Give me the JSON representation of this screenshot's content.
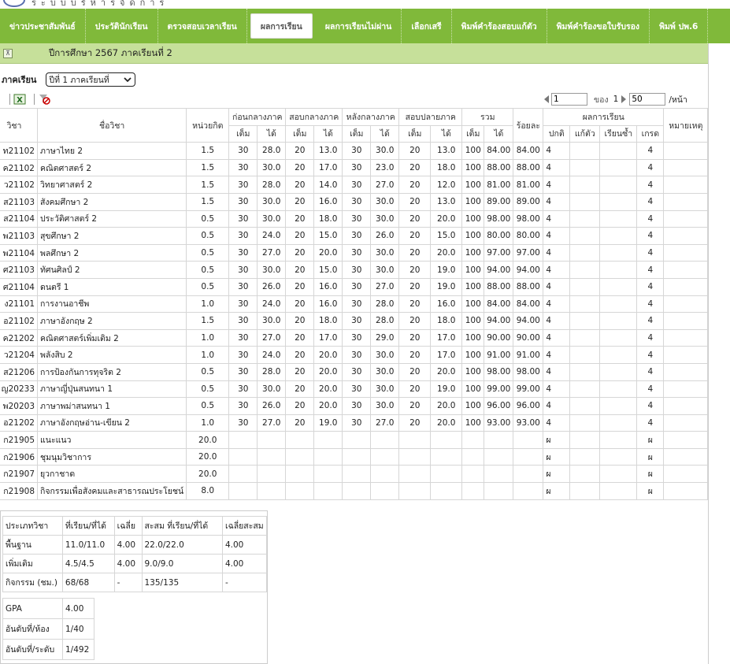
{
  "top_strip_text": "ระบบบริหารจัดการ",
  "nav": {
    "tabs": [
      {
        "label": "ข่าวประชาสัมพันธ์",
        "active": false
      },
      {
        "label": "ประวัตินักเรียน",
        "active": false
      },
      {
        "label": "ตรวจสอบเวลาเรียน",
        "active": false
      },
      {
        "label": "ผลการเรียน",
        "active": true
      },
      {
        "label": "ผลการเรียนไม่ผ่าน",
        "active": false
      },
      {
        "label": "เลือกเสรี",
        "active": false
      },
      {
        "label": "พิมพ์คำร้องสอบแก้ตัว",
        "active": false
      },
      {
        "label": "พิมพ์คำร้องขอใบรับรอง",
        "active": false
      },
      {
        "label": "พิมพ์ ปพ.6",
        "active": false
      }
    ]
  },
  "panel": {
    "collapse_icon": "⊼",
    "title": "ปีการศึกษา 2567 ภาคเรียนที่ 2"
  },
  "semester": {
    "label": "ภาคเรียน",
    "selected": "ปีที่ 1 ภาคเรียนที่"
  },
  "pager": {
    "page": "1",
    "of_label": "ของ",
    "total_pages": "1",
    "page_size": "50",
    "per_page_label": "/หน้า"
  },
  "table": {
    "headers": {
      "code": "วิชา",
      "name": "ชื่อวิชา",
      "credit": "หน่วยกิต",
      "midterm_before": "ก่อนกลางภาค",
      "midterm": "สอบกลางภาค",
      "after_mid": "หลังกลางภาค",
      "final": "สอบปลายภาค",
      "total": "รวม",
      "percent": "ร้อยละ",
      "result": "ผลการเรียน",
      "remark": "หมายเหตุ",
      "full": "เต็ม",
      "got": "ได้",
      "normal": "ปกติ",
      "retest": "แก้ตัว",
      "repeat": "เรียนซ้ำ",
      "grade": "เกรด"
    },
    "rows": [
      {
        "code": "ท21102",
        "name": "ภาษาไทย 2",
        "credit": "1.5",
        "s": [
          "30",
          "28.0",
          "20",
          "13.0",
          "30",
          "30.0",
          "20",
          "13.0",
          "100",
          "84.00"
        ],
        "pct": "84.00",
        "normal": "4",
        "retest": "",
        "repeat": "",
        "grade": "4",
        "remark": ""
      },
      {
        "code": "ค21102",
        "name": "คณิตศาสตร์ 2",
        "credit": "1.5",
        "s": [
          "30",
          "30.0",
          "20",
          "17.0",
          "30",
          "23.0",
          "20",
          "18.0",
          "100",
          "88.00"
        ],
        "pct": "88.00",
        "normal": "4",
        "retest": "",
        "repeat": "",
        "grade": "4",
        "remark": ""
      },
      {
        "code": "ว21102",
        "name": "วิทยาศาสตร์ 2",
        "credit": "1.5",
        "s": [
          "30",
          "28.0",
          "20",
          "14.0",
          "30",
          "27.0",
          "20",
          "12.0",
          "100",
          "81.00"
        ],
        "pct": "81.00",
        "normal": "4",
        "retest": "",
        "repeat": "",
        "grade": "4",
        "remark": ""
      },
      {
        "code": "ส21103",
        "name": "สังคมศึกษา 2",
        "credit": "1.5",
        "s": [
          "30",
          "30.0",
          "20",
          "16.0",
          "30",
          "30.0",
          "20",
          "13.0",
          "100",
          "89.00"
        ],
        "pct": "89.00",
        "normal": "4",
        "retest": "",
        "repeat": "",
        "grade": "4",
        "remark": ""
      },
      {
        "code": "ส21104",
        "name": "ประวัติศาสตร์ 2",
        "credit": "0.5",
        "s": [
          "30",
          "30.0",
          "20",
          "18.0",
          "30",
          "30.0",
          "20",
          "20.0",
          "100",
          "98.00"
        ],
        "pct": "98.00",
        "normal": "4",
        "retest": "",
        "repeat": "",
        "grade": "4",
        "remark": ""
      },
      {
        "code": "พ21103",
        "name": "สุขศึกษา 2",
        "credit": "0.5",
        "s": [
          "30",
          "24.0",
          "20",
          "15.0",
          "30",
          "26.0",
          "20",
          "15.0",
          "100",
          "80.00"
        ],
        "pct": "80.00",
        "normal": "4",
        "retest": "",
        "repeat": "",
        "grade": "4",
        "remark": ""
      },
      {
        "code": "พ21104",
        "name": "พลศึกษา 2",
        "credit": "0.5",
        "s": [
          "30",
          "27.0",
          "20",
          "20.0",
          "30",
          "30.0",
          "20",
          "20.0",
          "100",
          "97.00"
        ],
        "pct": "97.00",
        "normal": "4",
        "retest": "",
        "repeat": "",
        "grade": "4",
        "remark": ""
      },
      {
        "code": "ศ21103",
        "name": "ทัศนศิลป์ 2",
        "credit": "0.5",
        "s": [
          "30",
          "30.0",
          "20",
          "15.0",
          "30",
          "30.0",
          "20",
          "19.0",
          "100",
          "94.00"
        ],
        "pct": "94.00",
        "normal": "4",
        "retest": "",
        "repeat": "",
        "grade": "4",
        "remark": ""
      },
      {
        "code": "ศ21104",
        "name": "ดนตรี 1",
        "credit": "0.5",
        "s": [
          "30",
          "26.0",
          "20",
          "16.0",
          "30",
          "27.0",
          "20",
          "19.0",
          "100",
          "88.00"
        ],
        "pct": "88.00",
        "normal": "4",
        "retest": "",
        "repeat": "",
        "grade": "4",
        "remark": ""
      },
      {
        "code": "ง21101",
        "name": "การงานอาชีพ",
        "credit": "1.0",
        "s": [
          "30",
          "24.0",
          "20",
          "16.0",
          "30",
          "28.0",
          "20",
          "16.0",
          "100",
          "84.00"
        ],
        "pct": "84.00",
        "normal": "4",
        "retest": "",
        "repeat": "",
        "grade": "4",
        "remark": ""
      },
      {
        "code": "อ21102",
        "name": "ภาษาอังกฤษ 2",
        "credit": "1.5",
        "s": [
          "30",
          "30.0",
          "20",
          "18.0",
          "30",
          "28.0",
          "20",
          "18.0",
          "100",
          "94.00"
        ],
        "pct": "94.00",
        "normal": "4",
        "retest": "",
        "repeat": "",
        "grade": "4",
        "remark": ""
      },
      {
        "code": "ค21202",
        "name": "คณิตศาสตร์เพิ่มเติม 2",
        "credit": "1.0",
        "s": [
          "30",
          "27.0",
          "20",
          "17.0",
          "30",
          "29.0",
          "20",
          "17.0",
          "100",
          "90.00"
        ],
        "pct": "90.00",
        "normal": "4",
        "retest": "",
        "repeat": "",
        "grade": "4",
        "remark": ""
      },
      {
        "code": "ว21204",
        "name": "พลังสิบ 2",
        "credit": "1.0",
        "s": [
          "30",
          "24.0",
          "20",
          "20.0",
          "30",
          "30.0",
          "20",
          "17.0",
          "100",
          "91.00"
        ],
        "pct": "91.00",
        "normal": "4",
        "retest": "",
        "repeat": "",
        "grade": "4",
        "remark": ""
      },
      {
        "code": "ส21206",
        "name": "การป้องกันการทุจริต 2",
        "credit": "0.5",
        "s": [
          "30",
          "28.0",
          "20",
          "20.0",
          "30",
          "30.0",
          "20",
          "20.0",
          "100",
          "98.00"
        ],
        "pct": "98.00",
        "normal": "4",
        "retest": "",
        "repeat": "",
        "grade": "4",
        "remark": ""
      },
      {
        "code": "ญ20233",
        "name": "ภาษาญี่ปุ่นสนทนา 1",
        "credit": "0.5",
        "s": [
          "30",
          "30.0",
          "20",
          "20.0",
          "30",
          "30.0",
          "20",
          "19.0",
          "100",
          "99.00"
        ],
        "pct": "99.00",
        "normal": "4",
        "retest": "",
        "repeat": "",
        "grade": "4",
        "remark": ""
      },
      {
        "code": "พ20203",
        "name": "ภาษาพม่าสนทนา 1",
        "credit": "0.5",
        "s": [
          "30",
          "26.0",
          "20",
          "20.0",
          "30",
          "30.0",
          "20",
          "20.0",
          "100",
          "96.00"
        ],
        "pct": "96.00",
        "normal": "4",
        "retest": "",
        "repeat": "",
        "grade": "4",
        "remark": ""
      },
      {
        "code": "อ21202",
        "name": "ภาษาอังกฤษอ่าน-เขียน 2",
        "credit": "1.0",
        "s": [
          "30",
          "27.0",
          "20",
          "19.0",
          "30",
          "27.0",
          "20",
          "20.0",
          "100",
          "93.00"
        ],
        "pct": "93.00",
        "normal": "4",
        "retest": "",
        "repeat": "",
        "grade": "4",
        "remark": ""
      },
      {
        "code": "ก21905",
        "name": "แนะแนว",
        "credit": "20.0",
        "s": [
          "",
          "",
          "",
          "",
          "",
          "",
          "",
          "",
          "",
          ""
        ],
        "pct": "",
        "normal": "ผ",
        "retest": "",
        "repeat": "",
        "grade": "ผ",
        "remark": ""
      },
      {
        "code": "ก21906",
        "name": "ชุมนุมวิชาการ",
        "credit": "20.0",
        "s": [
          "",
          "",
          "",
          "",
          "",
          "",
          "",
          "",
          "",
          ""
        ],
        "pct": "",
        "normal": "ผ",
        "retest": "",
        "repeat": "",
        "grade": "ผ",
        "remark": ""
      },
      {
        "code": "ก21907",
        "name": "ยุวกาชาด",
        "credit": "20.0",
        "s": [
          "",
          "",
          "",
          "",
          "",
          "",
          "",
          "",
          "",
          ""
        ],
        "pct": "",
        "normal": "ผ",
        "retest": "",
        "repeat": "",
        "grade": "ผ",
        "remark": ""
      },
      {
        "code": "ก21908",
        "name": "กิจกรรมเพื่อสังคมและสาธารณประโยชน์",
        "credit": "8.0",
        "s": [
          "",
          "",
          "",
          "",
          "",
          "",
          "",
          "",
          "",
          ""
        ],
        "pct": "",
        "normal": "ผ",
        "retest": "",
        "repeat": "",
        "grade": "ผ",
        "remark": ""
      }
    ]
  },
  "summary": {
    "headers": [
      "ประเภทวิชา",
      "ที่เรียน/ที่ได้",
      "เฉลี่ย",
      "สะสม ที่เรียน/ที่ได้",
      "เฉลี่ยสะสม"
    ],
    "rows": [
      [
        "พื้นฐาน",
        "11.0/11.0",
        "4.00",
        "22.0/22.0",
        "4.00"
      ],
      [
        "เพิ่มเติม",
        "4.5/4.5",
        "4.00",
        "9.0/9.0",
        "4.00"
      ],
      [
        "กิจกรรม (ชม.)",
        "68/68",
        "-",
        "135/135",
        "-"
      ]
    ],
    "gpa_rows": [
      [
        "GPA",
        "4.00"
      ],
      [
        "อันดับที่/ห้อง",
        "1/40"
      ],
      [
        "อันดับที่/ระดับ",
        "1/492"
      ]
    ]
  }
}
